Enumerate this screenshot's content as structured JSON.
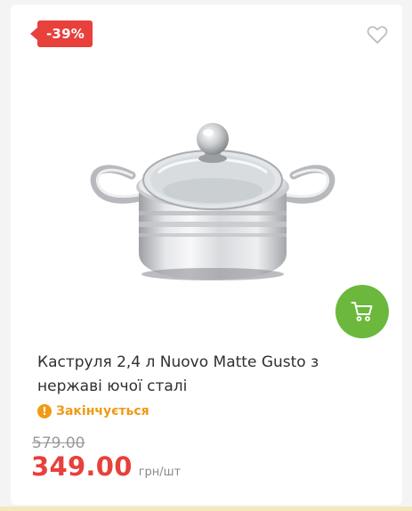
{
  "product": {
    "discount_badge": "-39%",
    "title": "Каструля 2,4 л Nuovo Matte Gusto з нержаві ючої сталі",
    "stock_status": "Закінчується",
    "old_price": "579.00",
    "price": "349.00",
    "unit": "грн/шт"
  },
  "icons": {
    "wishlist": "heart-icon",
    "cart": "cart-icon",
    "stock": "warning-icon"
  },
  "colors": {
    "badge": "#e8403b",
    "price": "#e8403b",
    "cart_button": "#6bb83c",
    "stock_warning": "#f09a16"
  }
}
